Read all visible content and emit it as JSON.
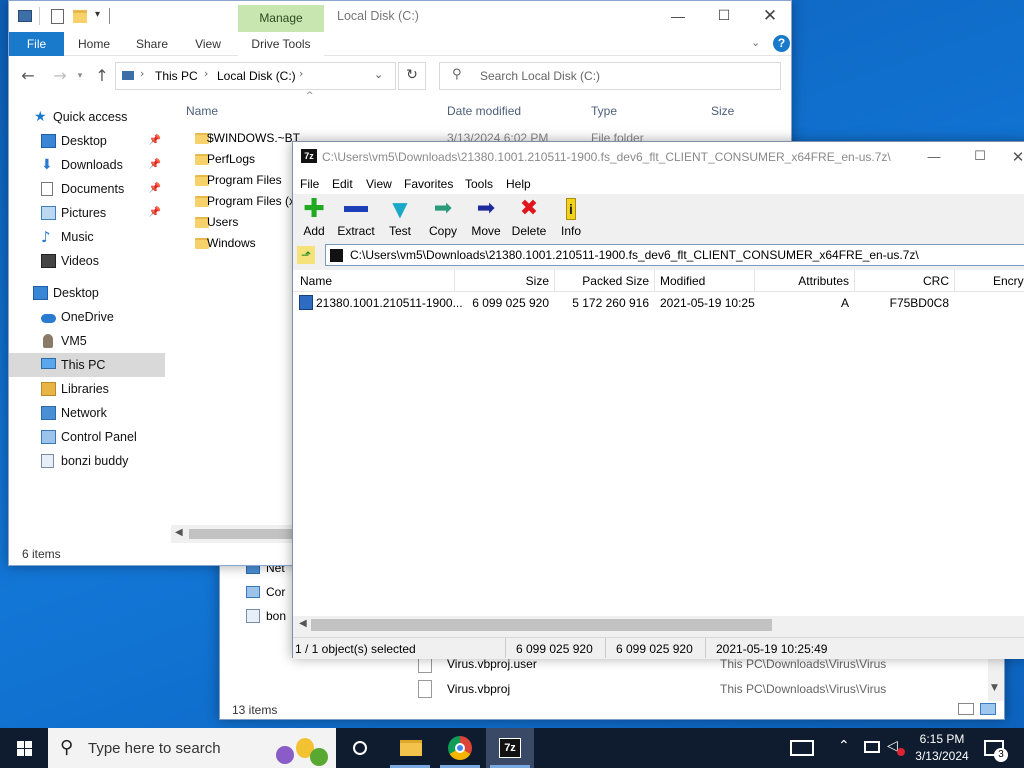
{
  "explorer_back": {
    "nav": [
      {
        "label": "Net"
      },
      {
        "label": "Cor"
      },
      {
        "label": "bon"
      }
    ],
    "rows": [
      {
        "name": "Virus.vbproj.user",
        "location": "This PC\\Downloads\\Virus\\Virus"
      },
      {
        "name": "Virus.vbproj",
        "location": "This PC\\Downloads\\Virus\\Virus"
      }
    ],
    "status": "13 items"
  },
  "explorer": {
    "title": "Local Disk (C:)",
    "context_tab": "Manage",
    "tabs": [
      "File",
      "Home",
      "Share",
      "View",
      "Drive Tools"
    ],
    "address": {
      "parts": [
        "This PC",
        "Local Disk (C:)"
      ]
    },
    "search_placeholder": "Search Local Disk (C:)",
    "columns": {
      "name": "Name",
      "date": "Date modified",
      "type": "Type",
      "size": "Size"
    },
    "files": [
      {
        "name": "$WINDOWS.~BT",
        "date": "3/13/2024 6:02 PM",
        "type": "File folder"
      },
      {
        "name": "PerfLogs"
      },
      {
        "name": "Program Files"
      },
      {
        "name": "Program Files (x"
      },
      {
        "name": "Users"
      },
      {
        "name": "Windows"
      }
    ],
    "nav": {
      "quick_access": "Quick access",
      "quick_items": [
        {
          "label": "Desktop",
          "icon": "desktop-icon"
        },
        {
          "label": "Downloads",
          "icon": "downloads-icon"
        },
        {
          "label": "Documents",
          "icon": "documents-icon"
        },
        {
          "label": "Pictures",
          "icon": "pictures-icon"
        },
        {
          "label": "Music",
          "icon": "music-icon"
        },
        {
          "label": "Videos",
          "icon": "videos-icon"
        }
      ],
      "desktop": "Desktop",
      "tree": [
        {
          "label": "OneDrive",
          "icon": "onedrive-icon"
        },
        {
          "label": "VM5",
          "icon": "user-icon"
        },
        {
          "label": "This PC",
          "icon": "this-pc-icon"
        },
        {
          "label": "Libraries",
          "icon": "libraries-icon"
        },
        {
          "label": "Network",
          "icon": "network-icon"
        },
        {
          "label": "Control Panel",
          "icon": "control-panel-icon"
        },
        {
          "label": "bonzi buddy",
          "icon": "bonzi-icon"
        }
      ]
    },
    "status": "6 items"
  },
  "sevenzip": {
    "title": "C:\\Users\\vm5\\Downloads\\21380.1001.210511-1900.fs_dev6_flt_CLIENT_CONSUMER_x64FRE_en-us.7z\\",
    "menu": [
      "File",
      "Edit",
      "View",
      "Favorites",
      "Tools",
      "Help"
    ],
    "tools": [
      "Add",
      "Extract",
      "Test",
      "Copy",
      "Move",
      "Delete",
      "Info"
    ],
    "path": "C:\\Users\\vm5\\Downloads\\21380.1001.210511-1900.fs_dev6_flt_CLIENT_CONSUMER_x64FRE_en-us.7z\\",
    "columns": [
      "Name",
      "Size",
      "Packed Size",
      "Modified",
      "Attributes",
      "CRC",
      "Encry"
    ],
    "rows": [
      {
        "name": "21380.1001.210511-1900...",
        "size": "6 099 025 920",
        "packed": "5 172 260 916",
        "modified": "2021-05-19 10:25",
        "attributes": "A",
        "crc": "F75BD0C8"
      }
    ],
    "status": {
      "selected": "1 / 1 object(s) selected",
      "size": "6 099 025 920",
      "size2": "6 099 025 920",
      "modified": "2021-05-19 10:25:49"
    }
  },
  "taskbar": {
    "search_placeholder": "Type here to search",
    "time": "6:15 PM",
    "date": "3/13/2024",
    "notification_count": "3",
    "pinned": [
      "task-view-icon",
      "file-explorer-icon",
      "chrome-icon",
      "7zip-icon"
    ]
  },
  "colors": {
    "accent": "#1979ca",
    "manage_tab": "#c8e6b0",
    "selection": "#cce8ff",
    "taskbar": "#0f1b2e"
  }
}
